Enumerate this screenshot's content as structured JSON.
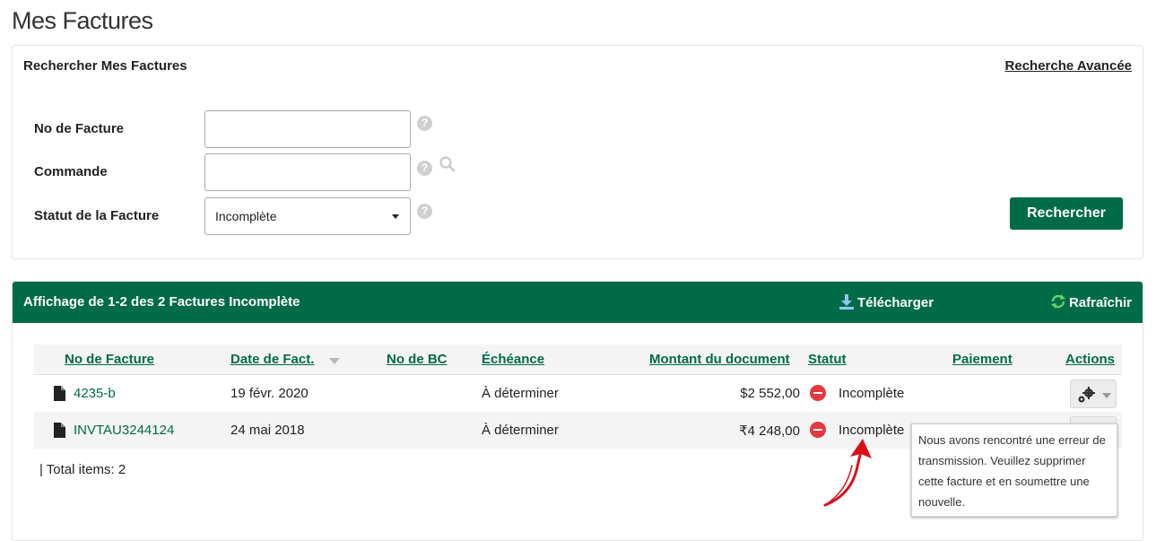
{
  "page": {
    "title": "Mes Factures"
  },
  "search": {
    "heading": "Rechercher Mes Factures",
    "advanced_link": "Recherche Avancée",
    "fields": {
      "invoice_no": {
        "label": "No de Facture",
        "value": ""
      },
      "order": {
        "label": "Commande",
        "value": ""
      },
      "status": {
        "label": "Statut de la Facture",
        "value": "Incomplète"
      }
    },
    "help_symbol": "?",
    "button": "Rechercher"
  },
  "results": {
    "header_title": "Affichage de 1-2 des 2 Factures Incomplète",
    "download_label": "Télécharger",
    "refresh_label": "Rafraîchir",
    "columns": {
      "invoice_no": "No de Facture",
      "invoice_date": "Date de Fact.",
      "po_no": "No de BC",
      "due": "Échéance",
      "amount": "Montant du document",
      "status": "Statut",
      "payment": "Paiement",
      "actions": "Actions"
    },
    "rows": [
      {
        "invoice_no": "4235-b",
        "date": "19 févr. 2020",
        "po_no": "",
        "due": "À déterminer",
        "amount": "$2 552,00",
        "status": "Incomplète",
        "payment": ""
      },
      {
        "invoice_no": "INVTAU3244124",
        "date": "24 mai 2018",
        "po_no": "",
        "due": "À déterminer",
        "amount": "₹4 248,00",
        "status": "Incomplète",
        "payment": ""
      }
    ],
    "total_items": "| Total items: 2"
  },
  "tooltip": {
    "text": "Nous avons rencontré une erreur de transmission. Veuillez supprimer cette facture et en soumettre une nouvelle."
  },
  "colors": {
    "brand_green": "#006b47",
    "status_red": "#e2393f",
    "annotation_red": "#d9101a"
  },
  "icons": [
    "help-icon",
    "magnifier-icon",
    "caret-down-icon",
    "download-icon",
    "refresh-icon",
    "sort-caret-icon",
    "document-icon",
    "status-error-icon",
    "gear-icon",
    "annotation-arrow"
  ]
}
